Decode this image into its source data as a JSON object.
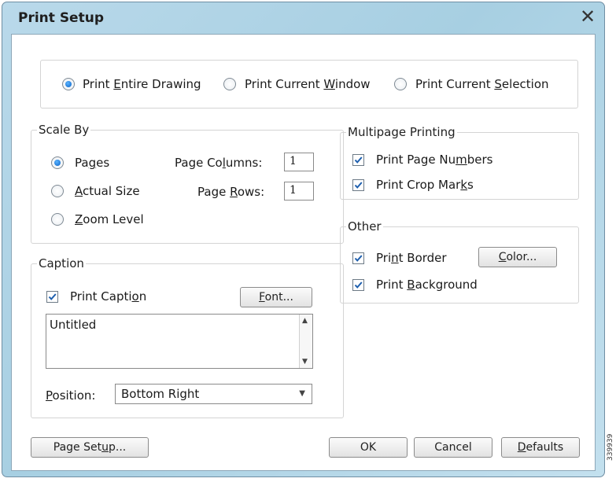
{
  "window": {
    "title": "Print Setup",
    "close_glyph": "✕"
  },
  "print_scope": {
    "options": [
      {
        "pre": "Print ",
        "u": "E",
        "post": "ntire Drawing",
        "selected": true
      },
      {
        "pre": "Print Current ",
        "u": "W",
        "post": "indow",
        "selected": false
      },
      {
        "pre": "Print Current ",
        "u": "S",
        "post": "election",
        "selected": false
      }
    ]
  },
  "scale_by": {
    "legend": "Scale By",
    "options": [
      {
        "pre": "Pa",
        "u": "g",
        "post": "es",
        "selected": true
      },
      {
        "pre": "",
        "u": "A",
        "post": "ctual Size",
        "selected": false
      },
      {
        "pre": "",
        "u": "Z",
        "post": "oom Level",
        "selected": false
      }
    ],
    "page_columns": {
      "pre": "Page Co",
      "u": "l",
      "post": "umns:",
      "value": "1"
    },
    "page_rows": {
      "pre": "Page ",
      "u": "R",
      "post": "ows:",
      "value": "1"
    }
  },
  "multipage": {
    "legend": "Multipage Printing",
    "items": [
      {
        "pre": "Print Page Nu",
        "u": "m",
        "post": "bers",
        "checked": true
      },
      {
        "pre": "Print Crop Mar",
        "u": "k",
        "post": "s",
        "checked": true
      }
    ]
  },
  "other": {
    "legend": "Other",
    "items": [
      {
        "pre": "Pri",
        "u": "n",
        "post": "t Border",
        "checked": true
      },
      {
        "pre": "Print ",
        "u": "B",
        "post": "ackground",
        "checked": true
      }
    ],
    "color_button": {
      "pre": "",
      "u": "C",
      "post": "olor..."
    }
  },
  "caption": {
    "legend": "Caption",
    "print_caption": {
      "pre": "Print Capti",
      "u": "o",
      "post": "n",
      "checked": true
    },
    "font_button": {
      "pre": "",
      "u": "F",
      "post": "ont..."
    },
    "text": "Untitled",
    "position_label": {
      "pre": "",
      "u": "P",
      "post": "osition:"
    },
    "position_value": "Bottom Right"
  },
  "footer": {
    "page_setup": {
      "pre": "Page Set",
      "u": "u",
      "post": "p..."
    },
    "ok": "OK",
    "cancel": "Cancel",
    "defaults": {
      "pre": "",
      "u": "D",
      "post": "efaults"
    }
  },
  "side_code": "339939",
  "colors": {
    "accent": "#0a62c6",
    "frame": "#a7cfe2",
    "check": "#1e5fae"
  }
}
